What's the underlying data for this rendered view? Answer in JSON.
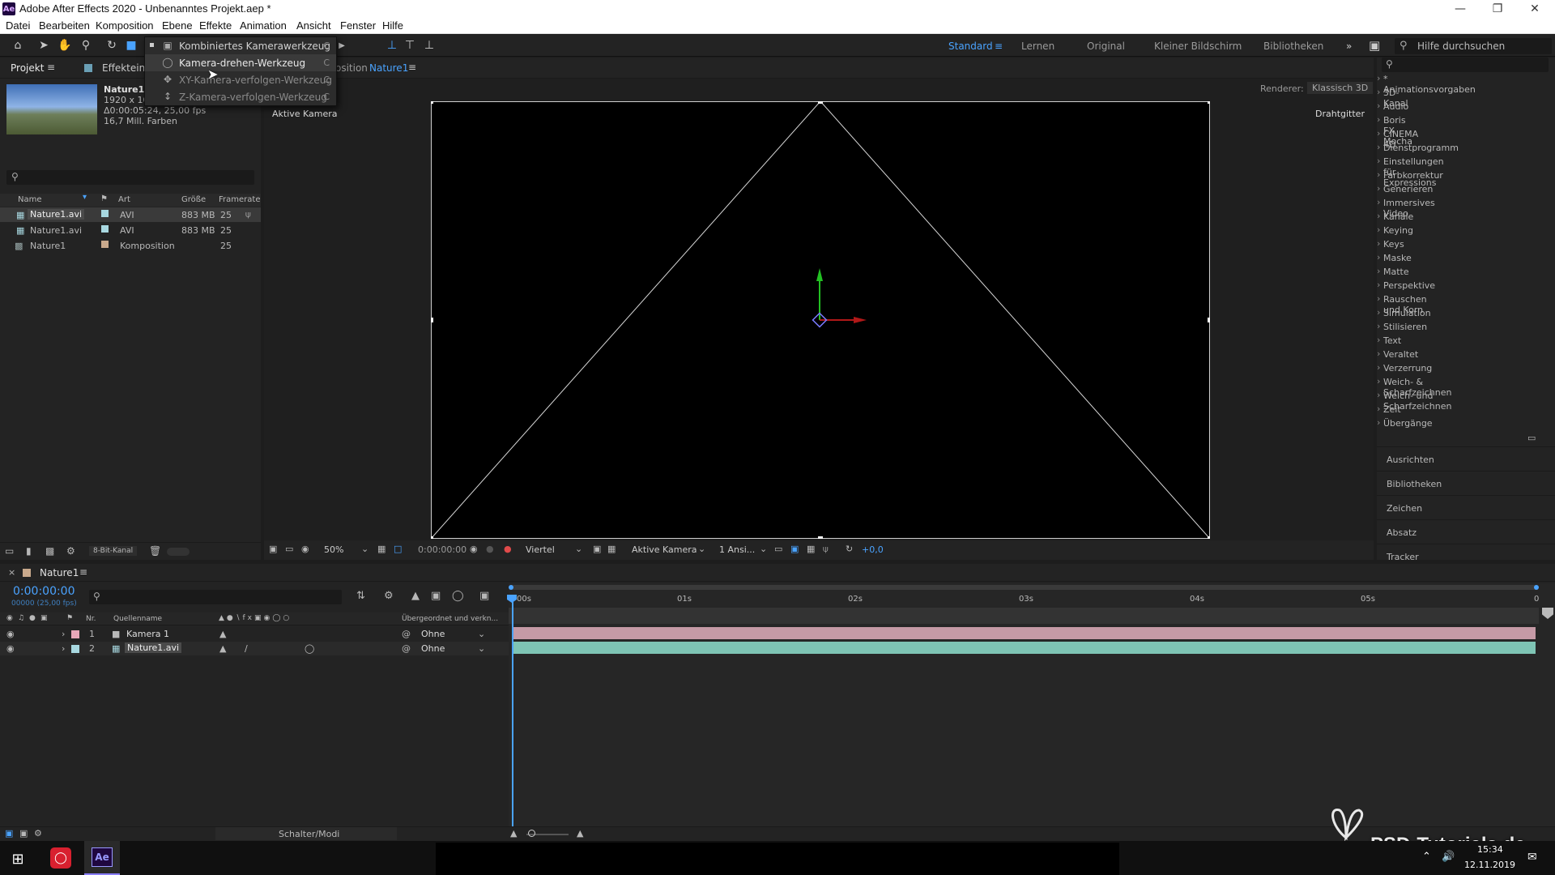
{
  "window": {
    "title": "Adobe After Effects 2020 - Unbenanntes Projekt.aep *",
    "app_icon": "Ae"
  },
  "menu": [
    "Datei",
    "Bearbeiten",
    "Komposition",
    "Ebene",
    "Effekte",
    "Animation",
    "Ansicht",
    "Fenster",
    "Hilfe"
  ],
  "toolbar": {
    "workspaces": [
      "Standard",
      "Lernen",
      "Original",
      "Kleiner Bildschirm",
      "Bibliotheken"
    ],
    "active_workspace": "Standard",
    "help_search": "Hilfe durchsuchen"
  },
  "camera_menu": {
    "items": [
      {
        "label": "Kombiniertes Kamerawerkzeug",
        "shortcut": "C"
      },
      {
        "label": "Kamera-drehen-Werkzeug",
        "shortcut": "C"
      },
      {
        "label": "XY-Kamera-verfolgen-Werkzeug",
        "shortcut": "C"
      },
      {
        "label": "Z-Kamera-verfolgen-Werkzeug",
        "shortcut": "C"
      }
    ]
  },
  "project": {
    "tab": "Projekt",
    "tab2": "Effekteins",
    "comp_tab_prefix": "osition",
    "comp_tab_name": "Nature1",
    "selected": {
      "name": "Nature1.a",
      "dims": "1920 x 108",
      "duration": "Δ0:00:05:24, 25,00 fps",
      "colors": "16,7 Mill. Farben"
    },
    "columns": [
      "Name",
      "Art",
      "Größe",
      "Framerate"
    ],
    "rows": [
      {
        "name": "Nature1.avi",
        "type": "AVI",
        "size": "883 MB",
        "fps": "25",
        "color": "#a8d8e0"
      },
      {
        "name": "Nature1.avi",
        "type": "AVI",
        "size": "883 MB",
        "fps": "25",
        "color": "#a8d8e0"
      },
      {
        "name": "Nature1",
        "type": "Komposition",
        "size": "",
        "fps": "25",
        "color": "#c9a98c"
      }
    ],
    "bit_depth": "8-Bit-Kanal"
  },
  "composition": {
    "renderer_label": "Renderer:",
    "renderer_value": "Klassisch 3D",
    "active_camera": "Aktive Kamera",
    "wireframe": "Drahtgitter",
    "zoom": "50%",
    "time": "0:00:00:00",
    "resolution": "Viertel",
    "camera_view": "Aktive Kamera",
    "views": "1 Ansi...",
    "exposure": "+0,0"
  },
  "effects": {
    "items": [
      "* Animationsvorgaben",
      "3D-Kanal",
      "Audio",
      "Boris FX Mocha",
      "CINEMA 4D",
      "Dienstprogramm",
      "Einstellungen für Expressions",
      "Farbkorrektur",
      "Generieren",
      "Immersives Video",
      "Kanäle",
      "Keying",
      "Keys",
      "Maske",
      "Matte",
      "Perspektive",
      "Rauschen und Korn",
      "Simulation",
      "Stilisieren",
      "Text",
      "Veraltet",
      "Verzerrung",
      "Weich- & Scharfzeichnen",
      "Weich- und Scharfzeichnen",
      "Zeit",
      "Übergänge"
    ],
    "panels": [
      "Ausrichten",
      "Bibliotheken",
      "Zeichen",
      "Absatz",
      "Tracker"
    ]
  },
  "timeline": {
    "tab": "Nature1",
    "timecode": "0:00:00:00",
    "timecode_sub": "00000 (25,00 fps)",
    "columns": {
      "nr": "Nr.",
      "source": "Quellenname",
      "parent": "Übergeordnet und verkn..."
    },
    "layers": [
      {
        "nr": "1",
        "name": "Kamera 1",
        "parent": "Ohne",
        "color": "#e8a7b8"
      },
      {
        "nr": "2",
        "name": "Nature1.avi",
        "parent": "Ohne",
        "color": "#a8d8e0"
      }
    ],
    "ruler": [
      "0s",
      "01s",
      "02s",
      "03s",
      "04s",
      "05s"
    ],
    "ruler_start": "00s",
    "ruler_end": "0",
    "switch_modes": "Schalter/Modi"
  },
  "taskbar": {
    "time": "15:34",
    "date": "12.11.2019"
  },
  "watermark": "PSD-Tutorials.de"
}
